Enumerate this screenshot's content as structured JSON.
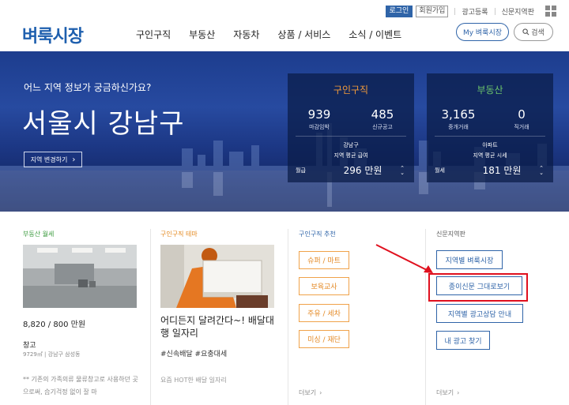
{
  "util": {
    "login": "로그인",
    "join": "회원가입",
    "ad_register": "광고등록",
    "newspaper_region": "신문지역판"
  },
  "header": {
    "logo": "벼룩시장",
    "nav": [
      "구인구직",
      "부동산",
      "자동차",
      "상품 / 서비스",
      "소식 / 이벤트"
    ],
    "my_button": "My 벼룩시장",
    "search_button": "검색"
  },
  "hero": {
    "subtitle": "어느 지역 정보가 궁금하신가요?",
    "location": "서울시 강남구",
    "change_button": "지역 변경하기",
    "job_panel": {
      "title": "구인구직",
      "stat1_value": "939",
      "stat1_label": "마감임박",
      "stat2_value": "485",
      "stat2_label": "신규공고",
      "region": "강남구",
      "metric": "지역 평균 급여",
      "unit": "월급",
      "value": "296 만원"
    },
    "re_panel": {
      "title": "부동산",
      "stat1_value": "3,165",
      "stat1_label": "중개거래",
      "stat2_value": "0",
      "stat2_label": "직거래",
      "region": "아파트",
      "metric": "지역 평균 시세",
      "unit": "월세",
      "value": "181 만원"
    }
  },
  "col_realestate": {
    "heading": "부동산 월세",
    "price": "8,820 / 800 만원",
    "type": "창고",
    "detail": "9729㎡ | 강남구 삼성동",
    "desc": "** 기존의 가족의류 물류창고로 사용하던 곳으로써, 습기걱정 없이 잘 마"
  },
  "col_job": {
    "heading": "구인구직 테마",
    "title": "어디든지 달려간다~! 배달대행 일자리",
    "tags": "#신속배달 #요충대세",
    "desc": "요즘 HOT한 배달 일자리"
  },
  "col_recommend": {
    "heading": "구인구직 추천",
    "tags": [
      "슈퍼 / 마트",
      "보육교사",
      "주유 / 세차",
      "미싱 / 재단"
    ],
    "more": "더보기"
  },
  "col_paper": {
    "heading": "신문지역판",
    "buttons": [
      "지역별 벼룩시장",
      "종이신문 그대로보기",
      "지역별 광고상담 안내",
      "내 광고 찾기"
    ],
    "more": "더보기"
  },
  "colors": {
    "brand": "#1e5fae",
    "job": "#f29b3a",
    "realestate": "#6cc46b",
    "highlight": "#e0101e"
  }
}
